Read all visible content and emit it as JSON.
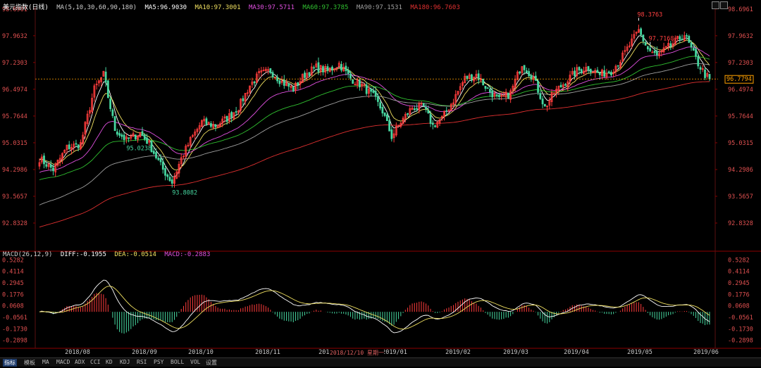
{
  "header": {
    "title": "美元指数(日线)",
    "ma_label": "MA(5,10,30,60,90,180)",
    "ma5": "MA5:96.9030",
    "ma10": "MA10:97.3001",
    "ma30": "MA30:97.5711",
    "ma60": "MA60:97.3785",
    "ma90": "MA90:97.1531",
    "ma180": "MA180:96.7603"
  },
  "macd_header": {
    "label": "MACD(26,12,9)",
    "diff": "DIFF:-0.1955",
    "dea": "DEA:-0.0514",
    "macd": "MACD:-0.2883"
  },
  "colors": {
    "up": "#ff3c3c",
    "down": "#46d7a0",
    "ma5": "#ffffff",
    "ma10": "#f0e060",
    "ma30": "#e050e0",
    "ma60": "#30c030",
    "ma90": "#a0a0a0",
    "ma180": "#e03030",
    "price_line": "#ffa000"
  },
  "bottom_tabs": [
    "指标",
    "模板",
    "MA",
    "MACD",
    "ADX",
    "CCI",
    "KD",
    "KDJ",
    "RSI",
    "PSY",
    "BOLL",
    "VOL",
    "设置"
  ],
  "date_overlay": "2018/12/10 星期一",
  "chart_data": [
    {
      "type": "candlestick",
      "title": "美元指数(日线)",
      "y_ticks": [
        "98.6961",
        "97.9632",
        "97.2303",
        "96.4974",
        "95.7644",
        "95.0315",
        "94.2986",
        "93.5657",
        "92.8328"
      ],
      "ylim": [
        92.1,
        98.75
      ],
      "x_ticks": [
        "2018/08",
        "2018/09",
        "2018/10",
        "2018/11",
        "2018/12",
        "2019/01",
        "2019/02",
        "2019/03",
        "2019/04",
        "2019/05",
        "2019/06"
      ],
      "current_price": "96.7794",
      "annotations": [
        {
          "label": "97.7168",
          "type": "high"
        },
        {
          "label": "98.3763",
          "type": "high"
        },
        {
          "label": "93.8082",
          "type": "low"
        },
        {
          "label": "95.0238",
          "type": "low"
        }
      ],
      "close_anchors": [
        [
          0,
          94.6
        ],
        [
          6,
          94.3
        ],
        [
          12,
          94.9
        ],
        [
          18,
          95.0
        ],
        [
          24,
          96.5
        ],
        [
          28,
          96.9
        ],
        [
          33,
          95.4
        ],
        [
          38,
          95.1
        ],
        [
          44,
          95.3
        ],
        [
          48,
          95.0
        ],
        [
          54,
          94.3
        ],
        [
          58,
          93.95
        ],
        [
          62,
          94.6
        ],
        [
          66,
          95.1
        ],
        [
          71,
          95.6
        ],
        [
          77,
          95.5
        ],
        [
          82,
          95.7
        ],
        [
          87,
          96.0
        ],
        [
          92,
          96.6
        ],
        [
          96,
          96.9
        ],
        [
          101,
          97.0
        ],
        [
          106,
          96.7
        ],
        [
          111,
          96.5
        ],
        [
          116,
          96.9
        ],
        [
          121,
          97.1
        ],
        [
          126,
          97.0
        ],
        [
          131,
          97.2
        ],
        [
          136,
          96.8
        ],
        [
          141,
          96.6
        ],
        [
          146,
          96.3
        ],
        [
          150,
          95.9
        ],
        [
          154,
          95.2
        ],
        [
          158,
          95.6
        ],
        [
          163,
          96.0
        ],
        [
          168,
          96.0
        ],
        [
          172,
          95.5
        ],
        [
          176,
          95.7
        ],
        [
          181,
          96.2
        ],
        [
          186,
          96.8
        ],
        [
          191,
          96.9
        ],
        [
          196,
          96.5
        ],
        [
          201,
          96.2
        ],
        [
          206,
          96.4
        ],
        [
          211,
          97.2
        ],
        [
          216,
          96.8
        ],
        [
          221,
          96.0
        ],
        [
          225,
          96.4
        ],
        [
          230,
          96.7
        ],
        [
          235,
          97.0
        ],
        [
          240,
          97.1
        ],
        [
          245,
          96.9
        ],
        [
          250,
          97.0
        ],
        [
          254,
          97.3
        ],
        [
          258,
          97.7
        ],
        [
          262,
          98.1
        ],
        [
          266,
          97.6
        ],
        [
          270,
          97.4
        ],
        [
          274,
          97.6
        ],
        [
          278,
          97.8
        ],
        [
          282,
          98.0
        ],
        [
          285,
          97.6
        ],
        [
          288,
          97.2
        ],
        [
          291,
          96.9
        ],
        [
          293,
          96.78
        ]
      ],
      "ma_start": [
        [
          94.6,
          94.6,
          94.2,
          94.0,
          93.3,
          92.7
        ],
        [
          94.7,
          94.7,
          94.3,
          94.1,
          93.5,
          92.75
        ]
      ]
    },
    {
      "type": "bar",
      "title": "MACD(26,12,9)",
      "y_ticks": [
        "0.5282",
        "0.4114",
        "0.2945",
        "0.1776",
        "0.0608",
        "-0.0561",
        "-0.1730",
        "-0.2898"
      ],
      "ylim": [
        -0.35,
        0.56
      ],
      "series": [
        {
          "name": "DIFF",
          "value": "-0.1955"
        },
        {
          "name": "DEA",
          "value": "-0.0514"
        },
        {
          "name": "MACD",
          "value": "-0.2883"
        }
      ]
    }
  ]
}
